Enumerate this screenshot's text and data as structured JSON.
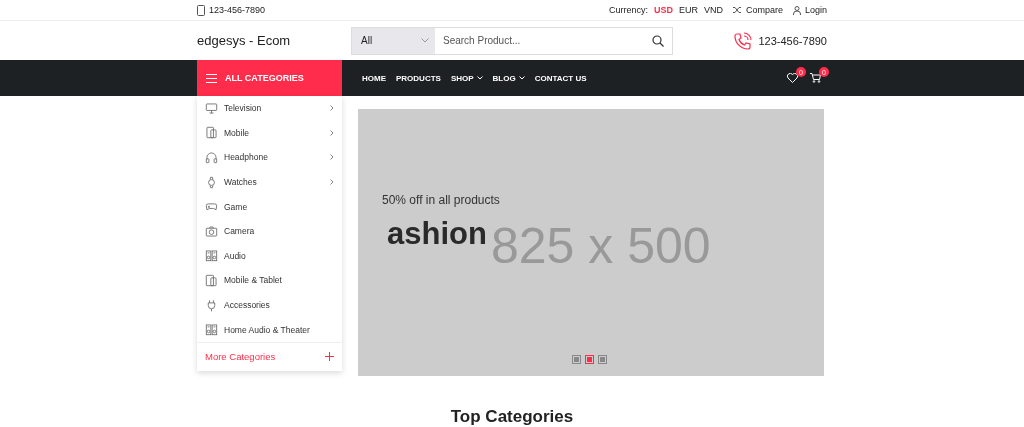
{
  "top_bar": {
    "phone": "123-456-7890",
    "currency_label": "Currency:",
    "currencies": [
      {
        "label": "USD",
        "selected": true
      },
      {
        "label": "EUR",
        "selected": false
      },
      {
        "label": "VND",
        "selected": false
      }
    ],
    "links": [
      "Compare",
      "Login"
    ]
  },
  "header": {
    "logo": "edgesys - Ecom",
    "search_category": "All",
    "search_placeholder": "Search Product...",
    "hotline": "123-456-7890"
  },
  "nav": {
    "categories_button": "ALL CATEGORIES",
    "menu": [
      {
        "label": "HOME",
        "dropdown": false
      },
      {
        "label": "PRODUCTS",
        "dropdown": false
      },
      {
        "label": "SHOP",
        "dropdown": true
      },
      {
        "label": "BLOG",
        "dropdown": true
      },
      {
        "label": "CONTACT US",
        "dropdown": false
      }
    ],
    "wishlist_count": "0",
    "cart_count": "0"
  },
  "sidebar": {
    "items": [
      {
        "label": "Television",
        "submenu": true
      },
      {
        "label": "Mobile",
        "submenu": true
      },
      {
        "label": "Headphone",
        "submenu": true
      },
      {
        "label": "Watches",
        "submenu": true
      },
      {
        "label": "Game",
        "submenu": false
      },
      {
        "label": "Camera",
        "submenu": false
      },
      {
        "label": "Audio",
        "submenu": false
      },
      {
        "label": "Mobile & Tablet",
        "submenu": false
      },
      {
        "label": "Accessories",
        "submenu": false
      },
      {
        "label": "Home Audio & Theater",
        "submenu": false
      }
    ],
    "more": "More Categories"
  },
  "banner": {
    "subtitle": "50% off in all products",
    "title": "ashion",
    "placeholder": "825 x 500",
    "dots": [
      {
        "selected": false
      },
      {
        "selected": true
      },
      {
        "selected": false
      }
    ]
  },
  "section_title": "Top Categories"
}
